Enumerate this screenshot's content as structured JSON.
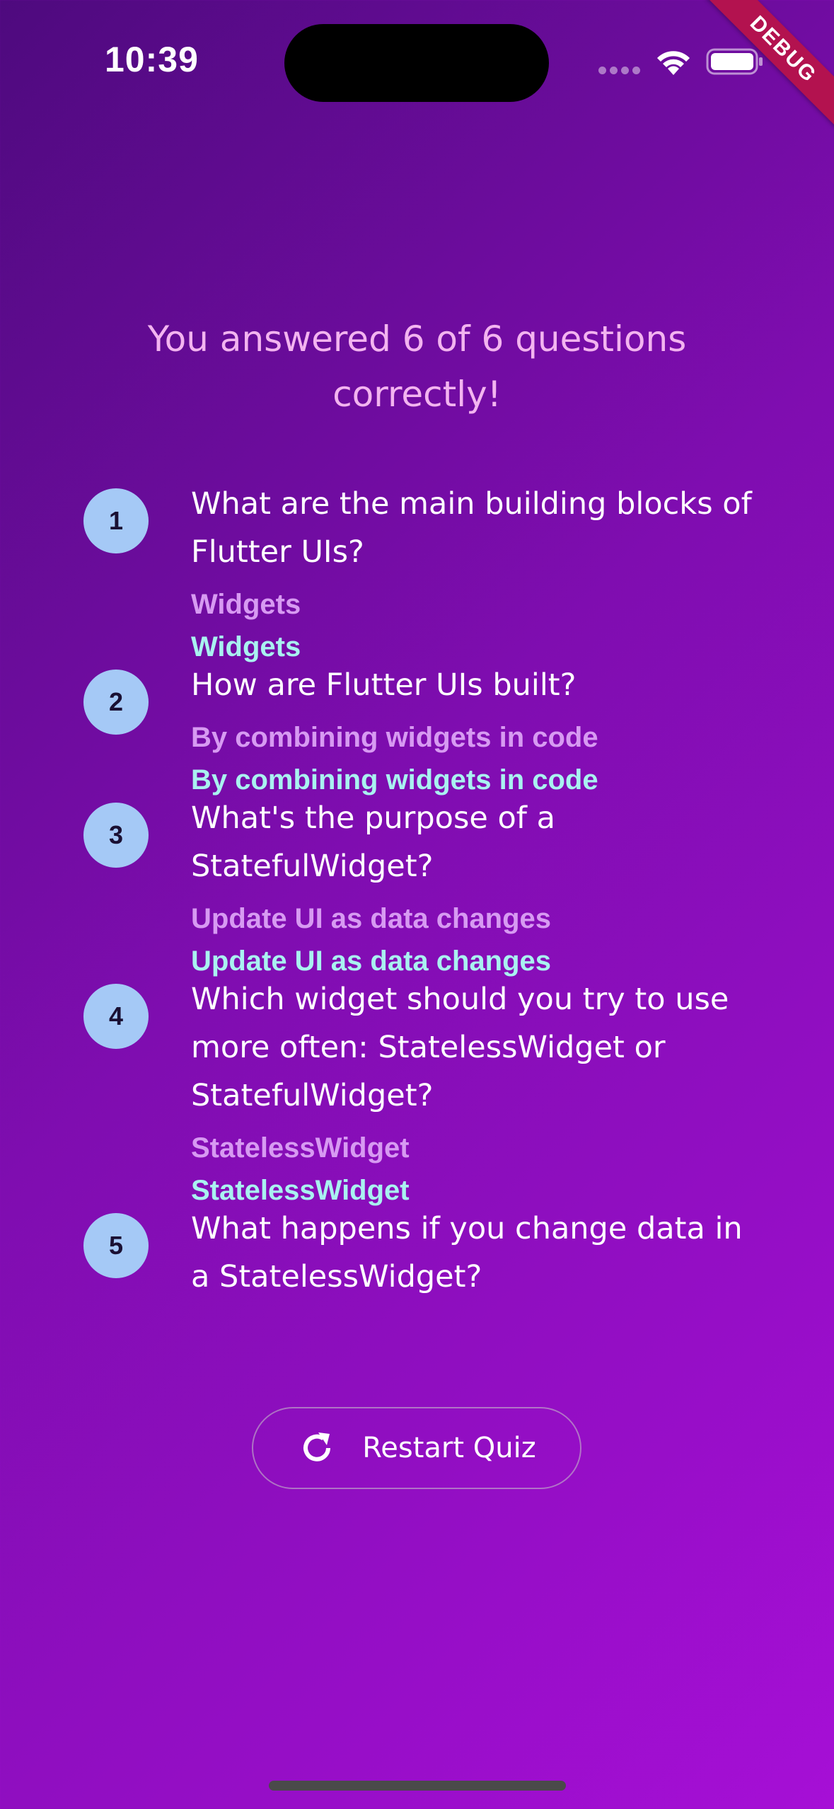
{
  "status_bar": {
    "time": "10:39"
  },
  "debug_banner": {
    "label": "DEBUG"
  },
  "summary": {
    "title": "You answered 6 of 6 questions correctly!"
  },
  "results": [
    {
      "index": "1",
      "question": "What are the main building blocks of Flutter UIs?",
      "user_answer": "Widgets",
      "correct_answer": "Widgets"
    },
    {
      "index": "2",
      "question": "How are Flutter UIs built?",
      "user_answer": "By combining widgets in code",
      "correct_answer": "By combining widgets in code"
    },
    {
      "index": "3",
      "question": "What's the purpose of a StatefulWidget?",
      "user_answer": "Update UI as data changes",
      "correct_answer": "Update UI as data changes"
    },
    {
      "index": "4",
      "question": "Which widget should you try to use more often: StatelessWidget or StatefulWidget?",
      "user_answer": "StatelessWidget",
      "correct_answer": "StatelessWidget"
    },
    {
      "index": "5",
      "question": "What happens if you change data in a StatelessWidget?"
    }
  ],
  "restart_button": {
    "label": "Restart Quiz",
    "icon": "refresh-icon"
  },
  "colors": {
    "background_start": "#4e0a7e",
    "background_end": "#a60fd6",
    "summary_text": "#f3b4f0",
    "index_circle": "#a5c9f6",
    "user_answer": "#d79af2",
    "correct_answer": "#a9f2f0",
    "debug_banner": "#b3124f"
  }
}
